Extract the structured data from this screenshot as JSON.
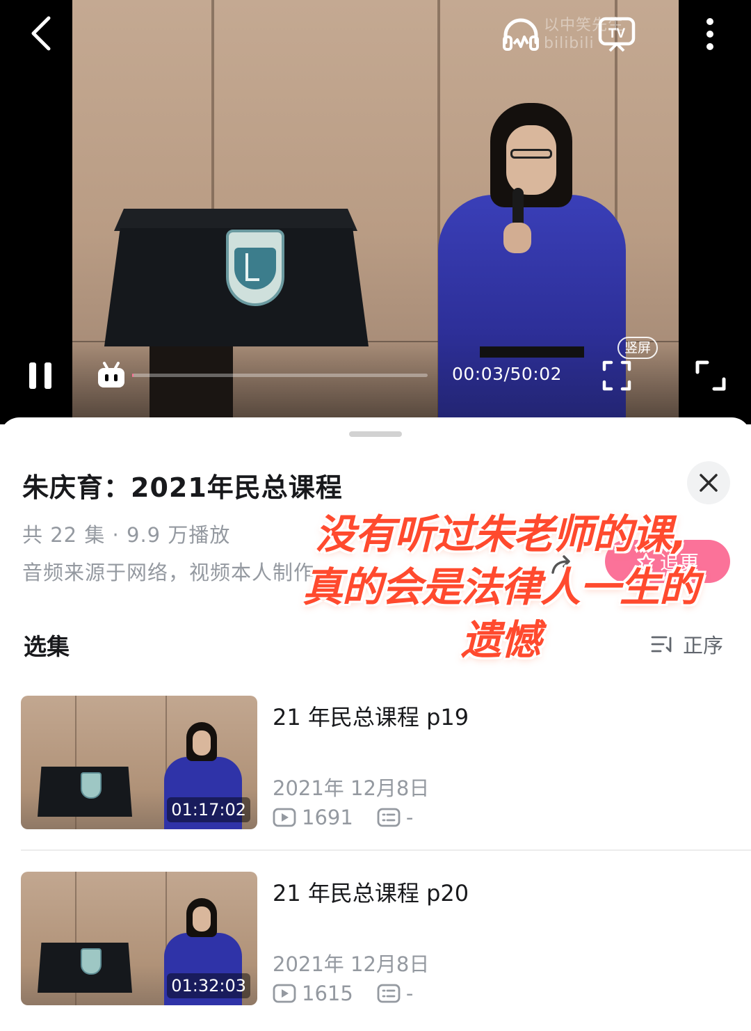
{
  "player": {
    "watermark": "以中笑先生 bilibili",
    "time": "00:03/50:02",
    "progress": 0.001,
    "vertical_label": "竖屏"
  },
  "sheet": {
    "title": "朱庆育：2021年民总课程",
    "meta": "共 22 集 · 9.9 万播放",
    "source": "音频来源于网络，视频本人制作",
    "follow_label": "追更",
    "overlay": [
      "没有听过朱老师的课,",
      "真的会是法律人一生的",
      "遗憾"
    ],
    "section_title": "选集",
    "order_label": "正序"
  },
  "episodes": [
    {
      "title": "21 年民总课程 p19",
      "duration": "01:17:02",
      "date": "2021年 12月8日",
      "plays": "1691",
      "danmaku": "-"
    },
    {
      "title": "21 年民总课程 p20",
      "duration": "01:32:03",
      "date": "2021年 12月8日",
      "plays": "1615",
      "danmaku": "-"
    }
  ],
  "colors": {
    "accent": "#fb7299",
    "overlay_text": "#ff4a2e",
    "muted_text": "#9499a0"
  },
  "icons": [
    "back-icon",
    "headphones-icon",
    "tv-cast-icon",
    "more-icon",
    "pause-icon",
    "danmaku-icon",
    "vertical-fullscreen-icon",
    "fullscreen-icon",
    "close-icon",
    "share-icon",
    "star-icon",
    "sort-icon",
    "play-count-icon",
    "danmaku-count-icon"
  ]
}
